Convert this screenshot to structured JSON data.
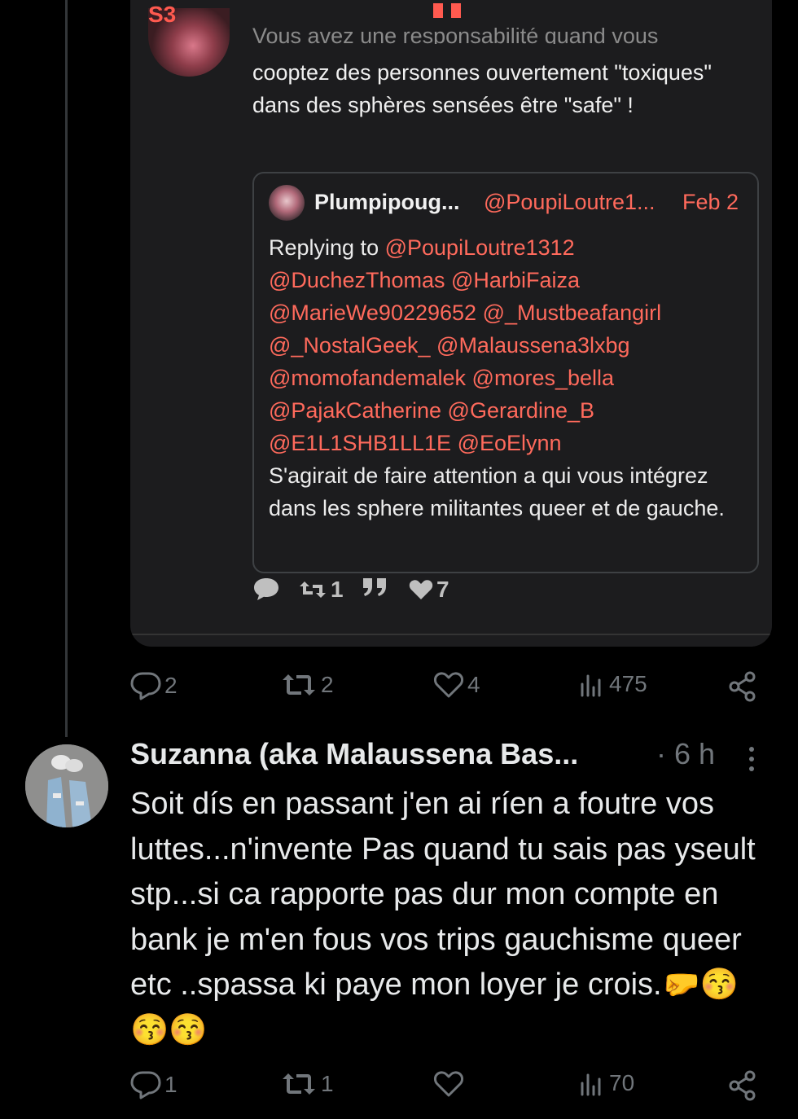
{
  "quoted_tweet": {
    "brand": "S3",
    "top_partial_text": "Vous avez une responsabilité quand vous",
    "body": "cooptez des personnes ouvertement \"toxiques\" dans des sphères sensées être \"safe\" !",
    "inner_quote": {
      "name": "Plumpipoug...",
      "handle": "@PoupiLoutre1...",
      "date": "Feb 2",
      "replying_to_label": "Replying to",
      "mentions": [
        "@PoupiLoutre1312",
        "@DuchezThomas",
        "@HarbiFaiza",
        "@MarieWe90229652",
        "@_Mustbeafangirl",
        "@_NostalGeek_",
        "@Malaussena3lxbg",
        "@momofandemalek",
        "@mores_bella",
        "@PajakCatherine",
        "@Gerardine_B",
        "@E1L1SHB1LL1E",
        "@EoElynn"
      ],
      "text": "S'agirait de faire attention a qui vous intégrez dans les sphere militantes queer et de gauche."
    },
    "actions": {
      "retweets": "1",
      "likes": "7"
    }
  },
  "main_tweet_actions": {
    "replies": "2",
    "retweets": "2",
    "likes": "4",
    "views": "475"
  },
  "reply": {
    "name": "Suzanna (aka Malaussena Bas...",
    "time": "· 6 h",
    "text": "Soit dís en passant j'en ai ríen a foutre vos luttes...n'invente Pas quand tu sais pas yseult stp...si ca rapporte pas dur mon compte en bank je m'en fous vos trips gauchisme queer etc ..spassa ki paye mon loyer je crois.🤛😚😚😚",
    "actions": {
      "replies": "1",
      "retweets": "1",
      "likes": "",
      "views": "70"
    }
  },
  "colors": {
    "accent": "#ff6a5c",
    "muted": "#71767b",
    "background": "#000000",
    "card": "#1c1c1e"
  },
  "icons": [
    "reply-icon",
    "retweet-icon",
    "like-icon",
    "views-icon",
    "share-icon",
    "more-icon",
    "quote-icon"
  ]
}
